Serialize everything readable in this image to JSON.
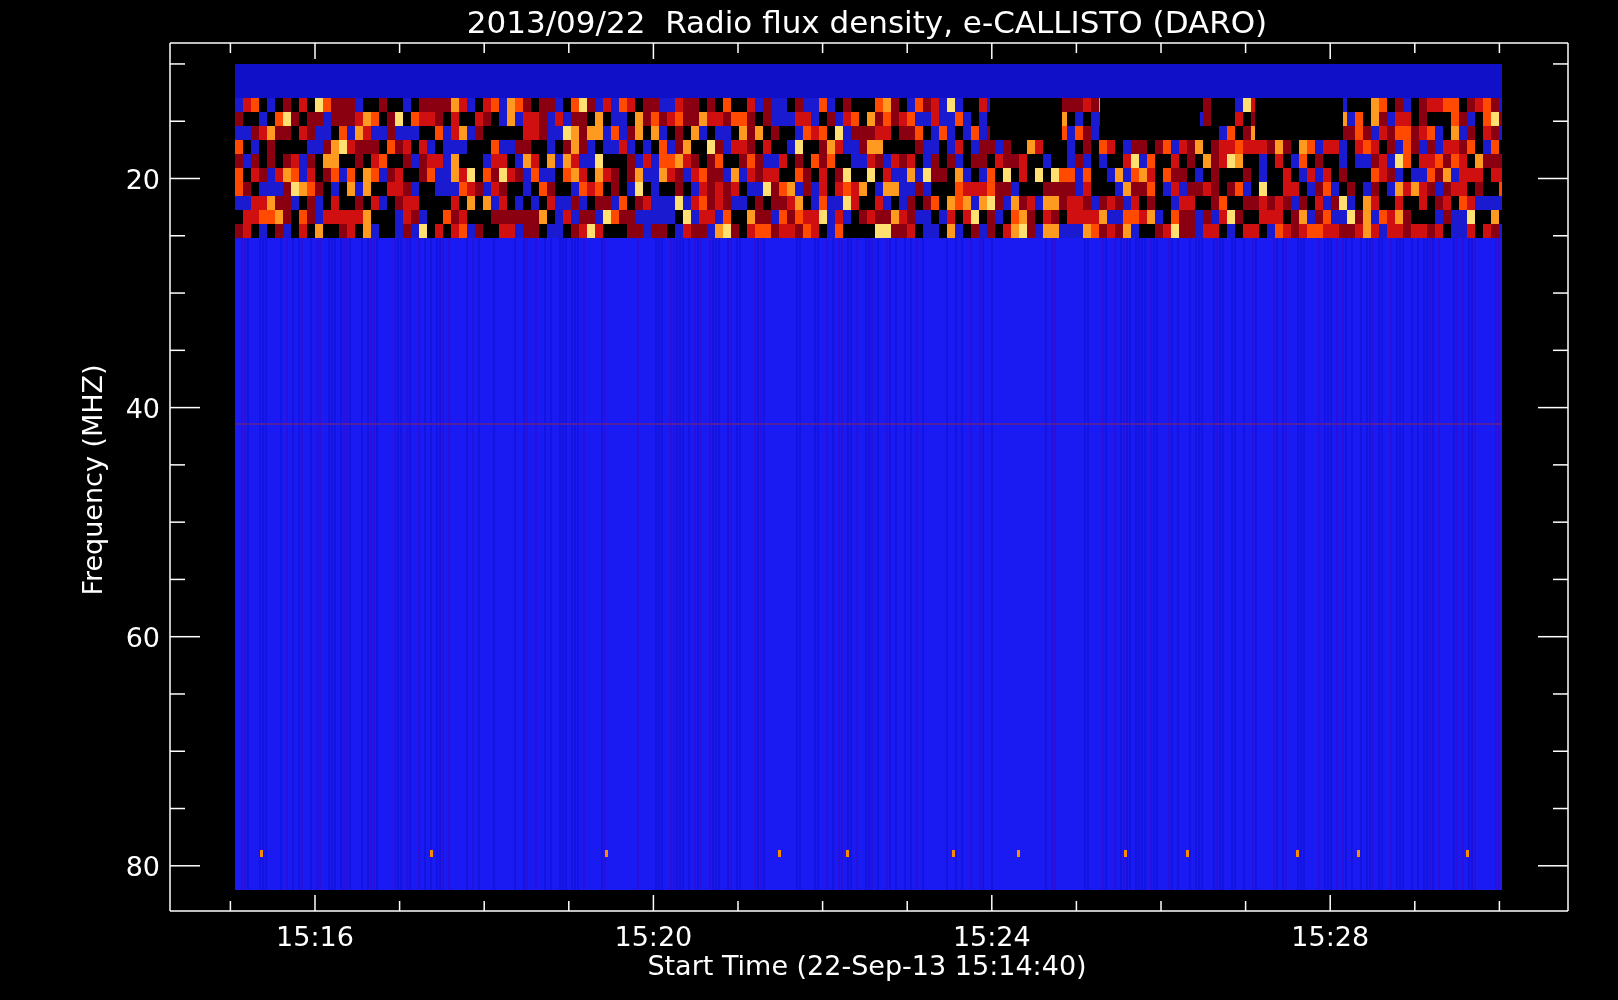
{
  "plot": {
    "title": "2013/09/22  Radio flux density, e-CALLISTO (DARO)",
    "xlabel": "Start Time (22-Sep-13 15:14:40)",
    "ylabel": "Frequency (MHZ)",
    "y_tick_labels": [
      "20",
      "40",
      "60",
      "80"
    ],
    "x_tick_labels": [
      "15:16",
      "15:20",
      "15:24",
      "15:28"
    ]
  }
}
